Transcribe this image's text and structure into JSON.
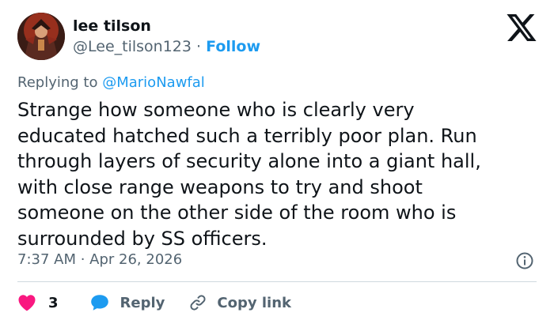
{
  "user": {
    "display_name": "lee tilson",
    "handle": "@Lee_tilson123",
    "separator": "·",
    "follow_label": "Follow"
  },
  "reply": {
    "prefix": "Replying to",
    "mention": "@MarioNawfal"
  },
  "tweet": {
    "lines": [
      "Strange how someone who is clearly very",
      "educated hatched such a terribly poor plan. Run",
      "through layers of security alone into a giant hall,",
      "with close range weapons to try and shoot",
      "someone on the other side of the room who is",
      "surrounded by SS officers."
    ],
    "timestamp": "7:37 AM · Apr 26, 2026"
  },
  "actions": {
    "like_count": "3",
    "reply_label": "Reply",
    "copy_label": "Copy link"
  },
  "colors": {
    "accent": "#1d9bf0",
    "like": "#f91880",
    "secondary_text": "#536471",
    "primary_text": "#0f1419"
  },
  "icons": {
    "brand": "x-logo-icon",
    "info": "info-icon",
    "like": "heart-icon",
    "reply": "speech-bubble-icon",
    "copy": "link-icon"
  }
}
